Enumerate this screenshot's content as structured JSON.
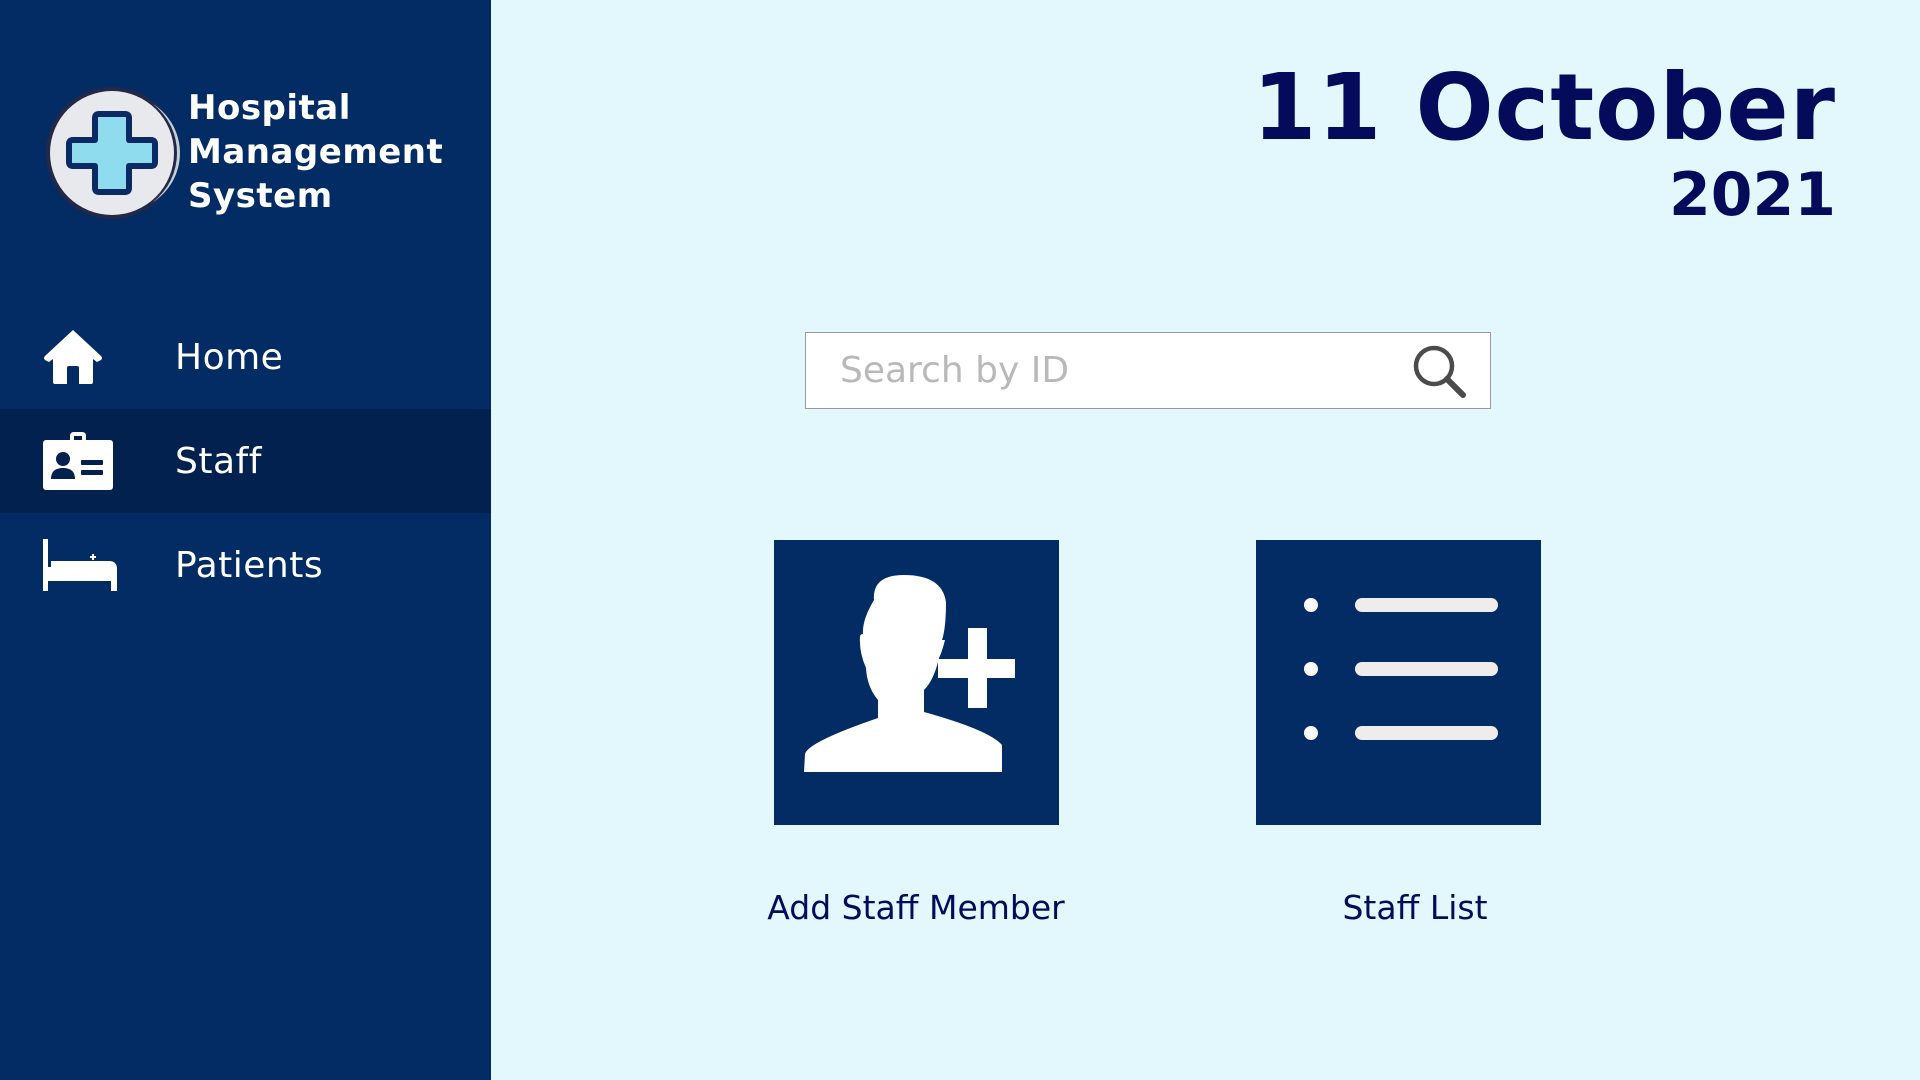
{
  "app": {
    "title_lines": [
      "Hospital",
      "Management",
      "System"
    ]
  },
  "date": {
    "day_month": "11 October",
    "year": "2021"
  },
  "sidebar": {
    "items": [
      {
        "label": "Home",
        "icon": "home-icon",
        "active": false
      },
      {
        "label": "Staff",
        "icon": "id-badge-icon",
        "active": true
      },
      {
        "label": "Patients",
        "icon": "bed-icon",
        "active": false
      }
    ]
  },
  "search": {
    "placeholder": "Search by ID",
    "value": ""
  },
  "actions": {
    "add_staff_label": "Add Staff Member",
    "staff_list_label": "Staff List"
  },
  "colors": {
    "sidebar_bg": "#032c65",
    "sidebar_active_bg": "#02214f",
    "page_bg": "#e3f8fd",
    "heading_text": "#060a5a",
    "logo_cross": "#8fdcef"
  }
}
